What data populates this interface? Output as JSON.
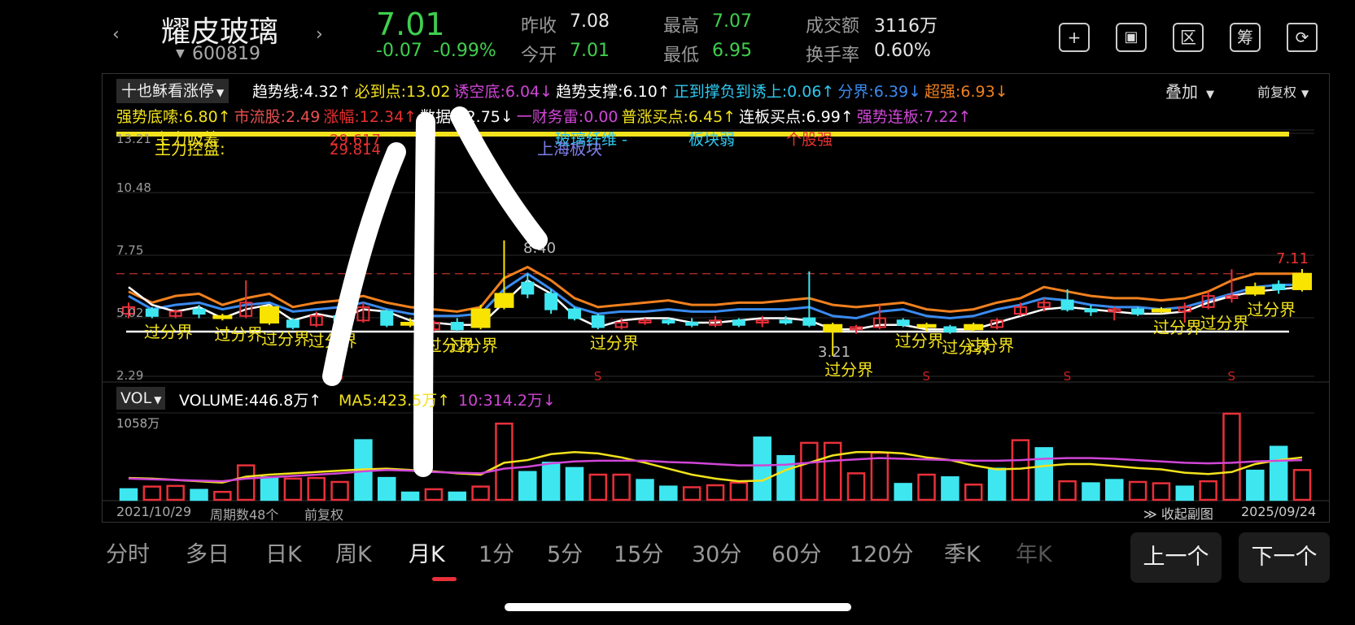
{
  "header": {
    "stock_name": "耀皮玻璃",
    "stock_code": "600819",
    "price": "7.01",
    "change": "-0.07",
    "change_pct": "-0.99%",
    "quotes": [
      {
        "label": "昨收",
        "value": "7.08",
        "color": "#e6e6e6"
      },
      {
        "label": "今开",
        "value": "7.01",
        "color": "#3fcf4e"
      },
      {
        "label": "最高",
        "value": "7.07",
        "color": "#3fcf4e"
      },
      {
        "label": "最低",
        "value": "6.95",
        "color": "#3fcf4e"
      },
      {
        "label": "成交额",
        "value": "3116万",
        "color": "#e6e6e6"
      },
      {
        "label": "换手率",
        "value": "0.60%",
        "color": "#e6e6e6"
      }
    ],
    "tools": [
      {
        "icon": "plus-icon",
        "glyph": "+"
      },
      {
        "icon": "screen-icon",
        "glyph": "▣"
      },
      {
        "icon": "region-icon",
        "glyph": "区"
      },
      {
        "icon": "chips-icon",
        "glyph": "筹"
      },
      {
        "icon": "phone-rotate-icon",
        "glyph": "⟳"
      }
    ]
  },
  "indicator": {
    "selector": "十也稣看涨停",
    "overlay": "叠加",
    "fq": "前复权",
    "line1": [
      {
        "text": "趋势线:4.32↑",
        "color": "#ffffff"
      },
      {
        "text": "必到点:13.02",
        "color": "#f2e21c"
      },
      {
        "text": "诱空底:6.04↓",
        "color": "#d046d6"
      },
      {
        "text": "趋势支撑:6.10↑",
        "color": "#ffffff"
      },
      {
        "text": "正到撑负到诱上:0.06↑",
        "color": "#2ec8f0"
      },
      {
        "text": "分界:6.39↓",
        "color": "#3a8bf0"
      },
      {
        "text": "超强:6.93↓",
        "color": "#f0801e"
      }
    ],
    "line2": [
      {
        "text": "强势底嗦:6.80↑",
        "color": "#f2e21c"
      },
      {
        "text": "市流股:2.49",
        "color": "#e85050"
      },
      {
        "text": "涨幅:12.34↑",
        "color": "#e83030"
      },
      {
        "text": "数据:22.75↓",
        "color": "#ffffff"
      },
      {
        "text": "一财务雷:0.00",
        "color": "#d046d6"
      },
      {
        "text": "普涨买点:6.45↑",
        "color": "#f2e21c"
      },
      {
        "text": "连板买点:6.99↑",
        "color": "#ffffff"
      },
      {
        "text": "强势连板:7.22↑",
        "color": "#d046d6"
      }
    ]
  },
  "chart_data": {
    "type": "candlestick",
    "y_ticks": [
      "13.21",
      "10.48",
      "7.75",
      "5.02",
      "2.29"
    ],
    "ylim": [
      2.29,
      13.21
    ],
    "annotations": {
      "high_label": "8.40",
      "low_label": "3.21",
      "last_label": "7.11",
      "main_control": "主力控盘:",
      "main_control2": "主力吸筹",
      "num1": "29.617",
      "num2": "29.814",
      "sector1": "玻璃纤维 -",
      "sector2": "上海板块",
      "sector3": "板块弱",
      "sector4": "个股强",
      "cross_label": "过分界",
      "sell_mark": "S"
    },
    "candles": [
      {
        "o": 5.1,
        "c": 5.4,
        "h": 5.6,
        "l": 4.9
      },
      {
        "o": 5.3,
        "c": 5.0,
        "h": 5.4,
        "l": 4.9
      },
      {
        "o": 5.0,
        "c": 5.2,
        "h": 5.3,
        "l": 4.9
      },
      {
        "o": 5.3,
        "c": 5.1,
        "h": 5.5,
        "l": 4.9
      },
      {
        "o": 5.0,
        "c": 4.9,
        "h": 5.1,
        "l": 4.8
      },
      {
        "o": 5.0,
        "c": 5.6,
        "h": 6.6,
        "l": 4.9
      },
      {
        "o": 5.4,
        "c": 4.7,
        "h": 5.5,
        "l": 4.6
      },
      {
        "o": 4.8,
        "c": 4.5,
        "h": 4.9,
        "l": 4.4
      },
      {
        "o": 4.6,
        "c": 5.0,
        "h": 5.2,
        "l": 4.5
      },
      {
        "o": 5.0,
        "c": 4.8,
        "h": 5.2,
        "l": 4.7
      },
      {
        "o": 4.8,
        "c": 5.4,
        "h": 5.6,
        "l": 4.7
      },
      {
        "o": 5.2,
        "c": 4.6,
        "h": 5.3,
        "l": 4.5
      },
      {
        "o": 4.6,
        "c": 4.7,
        "h": 4.9,
        "l": 4.5
      },
      {
        "o": 4.4,
        "c": 4.7,
        "h": 4.8,
        "l": 4.3
      },
      {
        "o": 4.7,
        "c": 4.4,
        "h": 4.9,
        "l": 4.3
      },
      {
        "o": 4.5,
        "c": 5.3,
        "h": 5.5,
        "l": 4.4
      },
      {
        "o": 5.4,
        "c": 6.0,
        "h": 8.4,
        "l": 5.3
      },
      {
        "o": 6.5,
        "c": 6.0,
        "h": 6.9,
        "l": 5.8
      },
      {
        "o": 6.0,
        "c": 5.3,
        "h": 6.2,
        "l": 5.1
      },
      {
        "o": 5.3,
        "c": 4.9,
        "h": 5.4,
        "l": 4.8
      },
      {
        "o": 5.0,
        "c": 4.5,
        "h": 5.1,
        "l": 4.4
      },
      {
        "o": 4.5,
        "c": 4.7,
        "h": 4.9,
        "l": 4.4
      },
      {
        "o": 4.7,
        "c": 4.8,
        "h": 4.9,
        "l": 4.6
      },
      {
        "o": 4.8,
        "c": 4.7,
        "h": 4.9,
        "l": 4.6
      },
      {
        "o": 4.7,
        "c": 4.6,
        "h": 4.9,
        "l": 4.5
      },
      {
        "o": 4.6,
        "c": 4.8,
        "h": 5.0,
        "l": 4.5
      },
      {
        "o": 4.8,
        "c": 4.6,
        "h": 4.9,
        "l": 4.5
      },
      {
        "o": 4.7,
        "c": 4.8,
        "h": 5.0,
        "l": 4.5
      },
      {
        "o": 4.8,
        "c": 4.7,
        "h": 5.0,
        "l": 4.6
      },
      {
        "o": 4.9,
        "c": 4.6,
        "h": 7.0,
        "l": 4.5
      },
      {
        "o": 4.6,
        "c": 4.3,
        "h": 4.7,
        "l": 3.21
      },
      {
        "o": 4.4,
        "c": 4.5,
        "h": 4.6,
        "l": 4.2
      },
      {
        "o": 4.5,
        "c": 4.9,
        "h": 5.5,
        "l": 4.4
      },
      {
        "o": 4.8,
        "c": 4.6,
        "h": 4.9,
        "l": 4.5
      },
      {
        "o": 4.6,
        "c": 4.5,
        "h": 4.7,
        "l": 4.3
      },
      {
        "o": 4.5,
        "c": 4.3,
        "h": 4.6,
        "l": 4.2
      },
      {
        "o": 4.4,
        "c": 4.6,
        "h": 4.7,
        "l": 4.3
      },
      {
        "o": 4.5,
        "c": 4.8,
        "h": 4.9,
        "l": 4.4
      },
      {
        "o": 5.1,
        "c": 5.4,
        "h": 5.6,
        "l": 5.0
      },
      {
        "o": 5.4,
        "c": 5.6,
        "h": 5.8,
        "l": 5.2
      },
      {
        "o": 5.7,
        "c": 5.3,
        "h": 6.2,
        "l": 5.2
      },
      {
        "o": 5.3,
        "c": 5.2,
        "h": 5.5,
        "l": 5.0
      },
      {
        "o": 5.2,
        "c": 5.3,
        "h": 5.4,
        "l": 4.8
      },
      {
        "o": 5.3,
        "c": 5.1,
        "h": 5.4,
        "l": 5.0
      },
      {
        "o": 5.2,
        "c": 5.3,
        "h": 5.4,
        "l": 5.1
      },
      {
        "o": 5.2,
        "c": 5.4,
        "h": 5.6,
        "l": 4.7
      },
      {
        "o": 5.4,
        "c": 5.9,
        "h": 6.1,
        "l": 5.3
      },
      {
        "o": 5.8,
        "c": 5.9,
        "h": 7.1,
        "l": 5.6
      },
      {
        "o": 6.0,
        "c": 6.3,
        "h": 6.5,
        "l": 5.9
      },
      {
        "o": 6.4,
        "c": 6.2,
        "h": 6.6,
        "l": 6.0
      },
      {
        "o": 6.2,
        "c": 6.9,
        "h": 7.11,
        "l": 6.1
      }
    ],
    "highlight_idx": [
      4,
      6,
      12,
      15,
      16,
      30,
      34,
      36,
      44,
      48,
      50
    ],
    "sell_idx": [
      9,
      20,
      34,
      40,
      47
    ],
    "cross_idx": [
      1,
      4,
      6,
      8,
      13,
      14,
      20,
      30,
      33,
      35,
      36,
      44,
      46,
      48
    ],
    "support_level": 4.3,
    "dashed_level": 6.9,
    "lines": {
      "orange": [
        6.1,
        5.6,
        5.9,
        6.0,
        5.5,
        5.8,
        6.0,
        5.4,
        5.6,
        5.7,
        5.9,
        5.6,
        5.4,
        5.3,
        5.2,
        5.4,
        6.7,
        7.2,
        6.6,
        5.8,
        5.4,
        5.5,
        5.6,
        5.7,
        5.5,
        5.5,
        5.6,
        5.6,
        5.7,
        5.8,
        5.5,
        5.4,
        5.5,
        5.6,
        5.3,
        5.2,
        5.3,
        5.6,
        5.8,
        6.3,
        6.1,
        5.9,
        5.8,
        5.8,
        5.7,
        5.8,
        6.1,
        6.6,
        6.9,
        6.9,
        6.9
      ],
      "blue": [
        5.9,
        5.3,
        5.5,
        5.6,
        5.3,
        5.5,
        5.6,
        5.2,
        5.3,
        5.4,
        5.6,
        5.3,
        5.1,
        5.0,
        5.0,
        5.1,
        6.2,
        6.9,
        6.2,
        5.4,
        5.1,
        5.2,
        5.2,
        5.3,
        5.2,
        5.2,
        5.3,
        5.3,
        5.3,
        5.4,
        5.0,
        4.9,
        5.2,
        5.3,
        5.0,
        4.9,
        5.0,
        5.3,
        5.5,
        5.8,
        5.7,
        5.5,
        5.4,
        5.4,
        5.3,
        5.4,
        5.7,
        6.0,
        6.3,
        6.4,
        6.4
      ],
      "white": [
        6.3,
        5.5,
        5.2,
        5.4,
        4.9,
        5.3,
        5.5,
        4.8,
        5.1,
        4.9,
        5.3,
        5.2,
        4.8,
        4.7,
        4.6,
        4.6,
        5.6,
        6.6,
        6.0,
        5.0,
        4.5,
        4.8,
        4.9,
        4.9,
        4.7,
        4.7,
        4.8,
        4.9,
        4.9,
        4.8,
        4.4,
        4.4,
        4.6,
        4.6,
        4.4,
        4.4,
        4.4,
        4.7,
        5.0,
        5.3,
        5.4,
        5.3,
        5.2,
        5.1,
        5.1,
        5.2,
        5.6,
        5.9,
        6.1,
        6.2,
        6.3
      ]
    },
    "volume": {
      "selector": "VOL",
      "volume_label": "VOLUME:446.8万↑",
      "ma5_label": "MA5:423.5万↑",
      "ma10_label": "10:314.2万↓",
      "max_label": "1058万",
      "bars": [
        160,
        200,
        210,
        150,
        120,
        520,
        340,
        320,
        330,
        270,
        900,
        330,
        110,
        160,
        110,
        200,
        1150,
        420,
        560,
        480,
        380,
        380,
        300,
        200,
        190,
        220,
        260,
        940,
        660,
        860,
        860,
        400,
        710,
        240,
        380,
        340,
        230,
        470,
        900,
        780,
        280,
        250,
        300,
        270,
        250,
        200,
        280,
        1300,
        440,
        800,
        450
      ],
      "up": [
        true,
        false,
        false,
        true,
        false,
        false,
        true,
        false,
        false,
        false,
        true,
        true,
        true,
        false,
        true,
        false,
        false,
        true,
        true,
        true,
        false,
        false,
        true,
        true,
        false,
        false,
        false,
        true,
        true,
        false,
        false,
        false,
        false,
        true,
        false,
        true,
        false,
        true,
        false,
        true,
        false,
        true,
        true,
        false,
        false,
        true,
        false,
        false,
        true,
        true,
        false
      ],
      "ma5": [
        330,
        320,
        300,
        280,
        260,
        350,
        380,
        400,
        420,
        440,
        460,
        470,
        450,
        430,
        400,
        380,
        560,
        600,
        690,
        720,
        700,
        640,
        560,
        470,
        380,
        320,
        280,
        290,
        450,
        560,
        670,
        720,
        720,
        700,
        640,
        600,
        520,
        460,
        470,
        510,
        540,
        540,
        510,
        480,
        460,
        410,
        390,
        420,
        540,
        600,
        640
      ],
      "ma10": [
        320,
        310,
        300,
        290,
        280,
        320,
        340,
        360,
        380,
        400,
        430,
        450,
        440,
        420,
        410,
        400,
        470,
        500,
        550,
        580,
        590,
        590,
        590,
        570,
        560,
        540,
        520,
        520,
        530,
        560,
        590,
        610,
        630,
        620,
        610,
        600,
        590,
        590,
        600,
        620,
        630,
        630,
        620,
        600,
        580,
        560,
        550,
        560,
        580,
        590,
        600
      ]
    },
    "date_start": "2021/10/29",
    "period_count": "周期数48个",
    "fq_label": "前复权",
    "collapse": "≫ 收起副图",
    "date_end": "2025/09/24"
  },
  "period_tabs": [
    {
      "label": "分时",
      "active": false
    },
    {
      "label": "多日",
      "active": false
    },
    {
      "label": "日K",
      "active": false
    },
    {
      "label": "周K",
      "active": false
    },
    {
      "label": "月K",
      "active": true
    },
    {
      "label": "1分",
      "active": false
    },
    {
      "label": "5分",
      "active": false
    },
    {
      "label": "15分",
      "active": false
    },
    {
      "label": "30分",
      "active": false
    },
    {
      "label": "60分",
      "active": false
    },
    {
      "label": "120分",
      "active": false
    },
    {
      "label": "季K",
      "active": false
    },
    {
      "label": "年K",
      "active": false
    }
  ],
  "nav": {
    "prev": "上一个",
    "next": "下一个"
  },
  "colors": {
    "up": "#e8303a",
    "down": "#3ee6f0",
    "yellow": "#f2e21c",
    "orange": "#f0801e",
    "blue": "#3a8bf0",
    "green": "#3fcf4e"
  }
}
